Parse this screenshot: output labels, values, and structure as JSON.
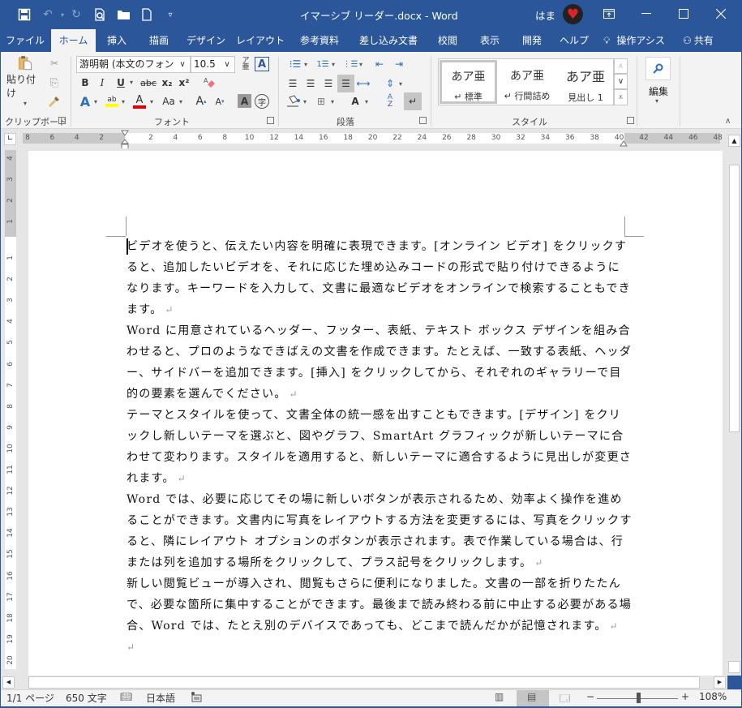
{
  "titlebar": {
    "title": "イマーシブ リーダー.docx  -  Word",
    "user": "はま",
    "avatar_icon": "heart-avatar",
    "qat": [
      {
        "name": "save-icon",
        "glyph": "🖫"
      },
      {
        "name": "undo-icon",
        "glyph": "↶"
      },
      {
        "name": "redo-icon",
        "glyph": "↻"
      },
      {
        "name": "print-preview-icon",
        "glyph": "🔍"
      },
      {
        "name": "open-folder-icon",
        "glyph": "📂"
      },
      {
        "name": "new-document-icon",
        "glyph": "🗋"
      },
      {
        "name": "customize-qat-icon",
        "glyph": "▿"
      }
    ],
    "window_buttons": {
      "ribbon_display": "⧉",
      "minimize": "—",
      "maximize": "☐",
      "close": "✕"
    }
  },
  "tabs": [
    "ファイル",
    "ホーム",
    "挿入",
    "描画",
    "デザイン",
    "レイアウト",
    "参考資料",
    "差し込み文書",
    "校閲",
    "表示",
    "開発",
    "ヘルプ"
  ],
  "active_tab": "ホーム",
  "tell_me": "操作アシス",
  "share": "共有",
  "ribbon": {
    "clipboard": {
      "label": "クリップボード",
      "paste": "貼り付け"
    },
    "font": {
      "label": "フォント",
      "font_name": "游明朝 (本文のフォント",
      "font_size": "10.5",
      "bold": "B",
      "italic": "I",
      "underline": "U",
      "strike": "abc",
      "subscript": "x₂",
      "superscript": "x²",
      "change_case": "Aa",
      "grow": "A",
      "shrink": "A",
      "highlight_color": "#ffff00",
      "font_color": "#e00000"
    },
    "paragraph": {
      "label": "段落"
    },
    "styles": {
      "label": "スタイル",
      "items": [
        {
          "sample": "あア亜",
          "name": "↵ 標準"
        },
        {
          "sample": "あア亜",
          "name": "↵ 行間詰め"
        },
        {
          "sample": "あア亜",
          "name": "見出し 1"
        }
      ]
    },
    "editing": {
      "label": "編集"
    }
  },
  "ruler": {
    "horizontal_ticks": [
      "8",
      "6",
      "4",
      "2",
      "",
      "2",
      "4",
      "6",
      "8",
      "10",
      "12",
      "14",
      "16",
      "18",
      "20",
      "22",
      "24",
      "26",
      "28",
      "30",
      "32",
      "34",
      "36",
      "38",
      "40",
      "42",
      "44",
      "46",
      "48"
    ],
    "vertical_ticks_top": [
      "4",
      "3",
      "2",
      "1"
    ],
    "vertical_ticks": [
      "1",
      "2",
      "3",
      "4",
      "5",
      "6",
      "7",
      "8",
      "9",
      "10",
      "11",
      "12",
      "13",
      "14",
      "15",
      "16",
      "17",
      "18",
      "19",
      "20"
    ]
  },
  "document": {
    "paragraphs": [
      "ビデオを使うと、伝えたい内容を明確に表現できます。[オンライン ビデオ] をクリックすると、追加したいビデオを、それに応じた埋め込みコードの形式で貼り付けできるようになります。キーワードを入力して、文書に最適なビデオをオンラインで検索することもできます。",
      "Word に用意されているヘッダー、フッター、表紙、テキスト ボックス デザインを組み合わせると、プロのようなできばえの文書を作成できます。たとえば、一致する表紙、ヘッダー、サイドバーを追加できます。[挿入] をクリックしてから、それぞれのギャラリーで目的の要素を選んでください。",
      "テーマとスタイルを使って、文書全体の統一感を出すこともできます。[デザイン] をクリックし新しいテーマを選ぶと、図やグラフ、SmartArt グラフィックが新しいテーマに合わせて変わります。スタイルを適用すると、新しいテーマに適合するように見出しが変更されます。",
      "Word では、必要に応じてその場に新しいボタンが表示されるため、効率よく操作を進めることができます。文書内に写真をレイアウトする方法を変更するには、写真をクリックすると、隣にレイアウト オプションのボタンが表示されます。表で作業している場合は、行または列を追加する場所をクリックして、プラス記号をクリックします。",
      "新しい閲覧ビューが導入され、閲覧もさらに便利になりました。文書の一部を折りたたんで、必要な箇所に集中することができます。最後まで読み終わる前に中止する必要がある場合、Word では、たとえ別のデバイスであっても、どこまで読んだかが記憶されます。",
      ""
    ],
    "paragraph_mark": "↵"
  },
  "status": {
    "page": "1/1 ページ",
    "words": "650 文字",
    "language": "日本語",
    "zoom_minus": "−",
    "zoom_plus": "+",
    "zoom": "108%",
    "zoom_percent": 108
  }
}
